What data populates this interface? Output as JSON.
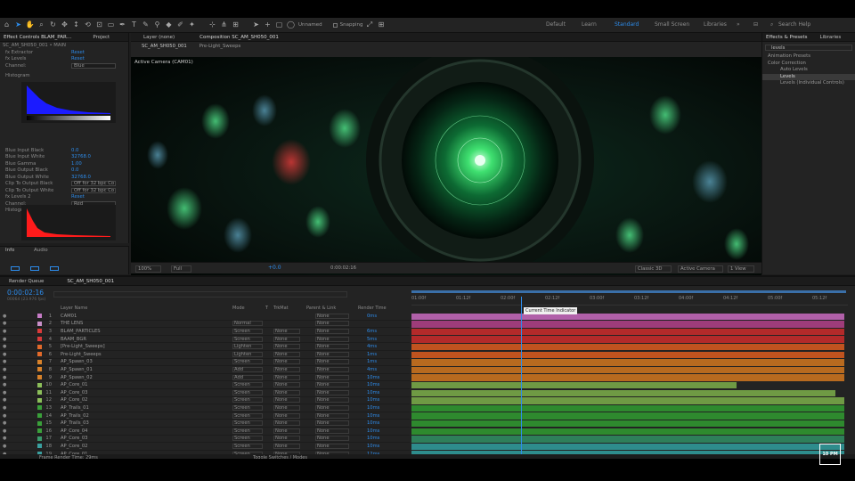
{
  "toolbar": {
    "snapping_label": "Snapping",
    "unnamed_label": "Unnamed",
    "workspaces": [
      "Default",
      "Learn",
      "Standard",
      "Small Screen",
      "Libraries"
    ],
    "active_workspace": "Standard",
    "search_placeholder": "Search Help"
  },
  "effect_controls": {
    "tabs": [
      "Effect Controls BLAM_PAR…",
      "Project"
    ],
    "title": "SC_AM_SH050_001 • MAIN",
    "rows": [
      {
        "label": "fx  Extractor",
        "value": "Reset"
      },
      {
        "label": "fx  Levels",
        "value": "Reset"
      },
      {
        "label": "Channel:",
        "value": "Blue",
        "dropdown": true
      },
      {
        "label": "Histogram",
        "value": ""
      },
      {
        "label": "Blue Input Black",
        "value": "0.0"
      },
      {
        "label": "Blue Input White",
        "value": "32768.0"
      },
      {
        "label": "Blue Gamma",
        "value": "1.00"
      },
      {
        "label": "Blue Output Black",
        "value": "0.0"
      },
      {
        "label": "Blue Output White",
        "value": "32768.0"
      },
      {
        "label": "Clip To Output Black",
        "value": "Off for 32 bpc Co",
        "dropdown": true
      },
      {
        "label": "Clip To Output White",
        "value": "Off for 32 bpc Co",
        "dropdown": true
      },
      {
        "label": "fx  Levels 2",
        "value": "Reset"
      },
      {
        "label": "Channel:",
        "value": "Red",
        "dropdown": true
      },
      {
        "label": "Histogram",
        "value": ""
      }
    ],
    "bottom_tabs": [
      "Info",
      "Audio"
    ]
  },
  "viewer": {
    "tabs": [
      "Layer (none)",
      "Composition SC_AM_SH050_001"
    ],
    "subtabs": [
      "SC_AM_SH050_001",
      "Pre-Light_Sweeps"
    ],
    "camera_label": "Active Camera (CAM01)",
    "zoom": "100%",
    "quality": "Full",
    "timecode": "0:00:02:16",
    "exposure": "+0.0",
    "renderer": "Classic 3D",
    "camera_dd": "Active Camera",
    "views_dd": "1 View"
  },
  "effects_presets": {
    "tabs": [
      "Effects & Presets",
      "Libraries"
    ],
    "search_value": "levels",
    "items": [
      {
        "label": "Animation Presets",
        "indent": 0
      },
      {
        "label": "Color Correction",
        "indent": 0
      },
      {
        "label": "Auto Levels",
        "indent": 1
      },
      {
        "label": "Levels",
        "indent": 1,
        "selected": true
      },
      {
        "label": "Levels (Individual Controls)",
        "indent": 1
      }
    ]
  },
  "timeline": {
    "tabs": [
      "Render Queue",
      "SC_AM_SH050_001"
    ],
    "timecode": "0:00:02:16",
    "frames": "00064 (23.976 fps)",
    "columns": [
      "Layer Name",
      "Mode",
      "T",
      "TrkMat",
      "Parent & Link",
      "Render Time"
    ],
    "ruler": [
      "01:00f",
      "01:12f",
      "02:00f",
      "02:12f",
      "03:00f",
      "03:12f",
      "04:00f",
      "04:12f",
      "05:00f",
      "05:12f",
      "06:00f"
    ],
    "tooltip": "Current Time Indicator",
    "footer_left": "Frame Render Time: 29ms",
    "footer_mid": "Toggle Switches / Modes",
    "layers": [
      {
        "num": "1",
        "name": "CAM01",
        "mode": "",
        "trk": "",
        "parent": "None",
        "rt": "0ms",
        "color": "#c77cc7",
        "bar": "#b160a9",
        "start": 0,
        "end": 1
      },
      {
        "num": "2",
        "name": "THE LENS",
        "mode": "Normal",
        "trk": "",
        "parent": "None",
        "rt": "",
        "color": "#c98fc9",
        "bar": "#9e3c7a",
        "start": 0,
        "end": 1
      },
      {
        "num": "3",
        "name": "BLAM_PARTICLES",
        "mode": "Screen",
        "trk": "None",
        "parent": "None",
        "rt": "6ms",
        "color": "#d83a3a",
        "bar": "#b32a2a",
        "start": 0,
        "end": 1
      },
      {
        "num": "4",
        "name": "BAAM_BGR",
        "mode": "Screen",
        "trk": "None",
        "parent": "None",
        "rt": "5ms",
        "color": "#d83a3a",
        "bar": "#b32a2a",
        "start": 0,
        "end": 1
      },
      {
        "num": "5",
        "name": "[Pre-Light_Sweeps]",
        "mode": "Lighten",
        "trk": "None",
        "parent": "None",
        "rt": "4ms",
        "color": "#e36a2a",
        "bar": "#c0531f",
        "start": 0,
        "end": 1
      },
      {
        "num": "6",
        "name": "Pre-Light_Sweeps",
        "mode": "Lighten",
        "trk": "None",
        "parent": "None",
        "rt": "1ms",
        "color": "#e36a2a",
        "bar": "#c0531f",
        "start": 0,
        "end": 1
      },
      {
        "num": "7",
        "name": "AP_Spawn_03",
        "mode": "Screen",
        "trk": "None",
        "parent": "None",
        "rt": "1ms",
        "color": "#d8822a",
        "bar": "#b86a1f",
        "start": 0,
        "end": 1
      },
      {
        "num": "8",
        "name": "AP_Spawn_01",
        "mode": "Add",
        "trk": "None",
        "parent": "None",
        "rt": "4ms",
        "color": "#d8822a",
        "bar": "#b86a1f",
        "start": 0,
        "end": 1
      },
      {
        "num": "9",
        "name": "AP_Spawn_02",
        "mode": "Add",
        "trk": "None",
        "parent": "None",
        "rt": "10ms",
        "color": "#d8822a",
        "bar": "#b86a1f",
        "start": 0,
        "end": 1
      },
      {
        "num": "10",
        "name": "AP_Core_01",
        "mode": "Screen",
        "trk": "None",
        "parent": "None",
        "rt": "10ms",
        "color": "#8cbf5a",
        "bar": "#6f9a44",
        "start": 0,
        "end": 0.75
      },
      {
        "num": "11",
        "name": "AP_Core_03",
        "mode": "Screen",
        "trk": "None",
        "parent": "None",
        "rt": "10ms",
        "color": "#8cbf5a",
        "bar": "#6f9a44",
        "start": 0,
        "end": 0.98
      },
      {
        "num": "12",
        "name": "AP_Core_02",
        "mode": "Screen",
        "trk": "None",
        "parent": "None",
        "rt": "10ms",
        "color": "#8cbf5a",
        "bar": "#6f9a44",
        "start": 0,
        "end": 1
      },
      {
        "num": "13",
        "name": "AP_Trails_01",
        "mode": "Screen",
        "trk": "None",
        "parent": "None",
        "rt": "10ms",
        "color": "#3aa03a",
        "bar": "#2e8a2e",
        "start": 0,
        "end": 1
      },
      {
        "num": "14",
        "name": "AP_Trails_02",
        "mode": "Screen",
        "trk": "None",
        "parent": "None",
        "rt": "10ms",
        "color": "#3aa03a",
        "bar": "#2e8a2e",
        "start": 0,
        "end": 1
      },
      {
        "num": "15",
        "name": "AP_Trails_03",
        "mode": "Screen",
        "trk": "None",
        "parent": "None",
        "rt": "10ms",
        "color": "#3aa03a",
        "bar": "#2e8a2e",
        "start": 0,
        "end": 1
      },
      {
        "num": "16",
        "name": "AP_Core_04",
        "mode": "Screen",
        "trk": "None",
        "parent": "None",
        "rt": "10ms",
        "color": "#3aa03a",
        "bar": "#2e8a2e",
        "start": 0,
        "end": 1
      },
      {
        "num": "17",
        "name": "AP_Core_03",
        "mode": "Screen",
        "trk": "None",
        "parent": "None",
        "rt": "10ms",
        "color": "#3a9a6a",
        "bar": "#2e7f5a",
        "start": 0,
        "end": 1
      },
      {
        "num": "18",
        "name": "AP_Core_02",
        "mode": "Screen",
        "trk": "None",
        "parent": "None",
        "rt": "10ms",
        "color": "#3aa0a0",
        "bar": "#2e8c8c",
        "start": 0,
        "end": 1
      },
      {
        "num": "19",
        "name": "AP_Core_01",
        "mode": "Screen",
        "trk": "None",
        "parent": "None",
        "rt": "12ms",
        "color": "#3aa0a0",
        "bar": "#2e8c8c",
        "start": 0,
        "end": 1
      },
      {
        "num": "20",
        "name": "MAIN",
        "mode": "Normal",
        "trk": "None",
        "parent": "None",
        "rt": "27ms",
        "color": "#3aa0a0",
        "bar": "#2e9090",
        "start": 0,
        "end": 1
      }
    ]
  },
  "corner_logo": "10 PM"
}
